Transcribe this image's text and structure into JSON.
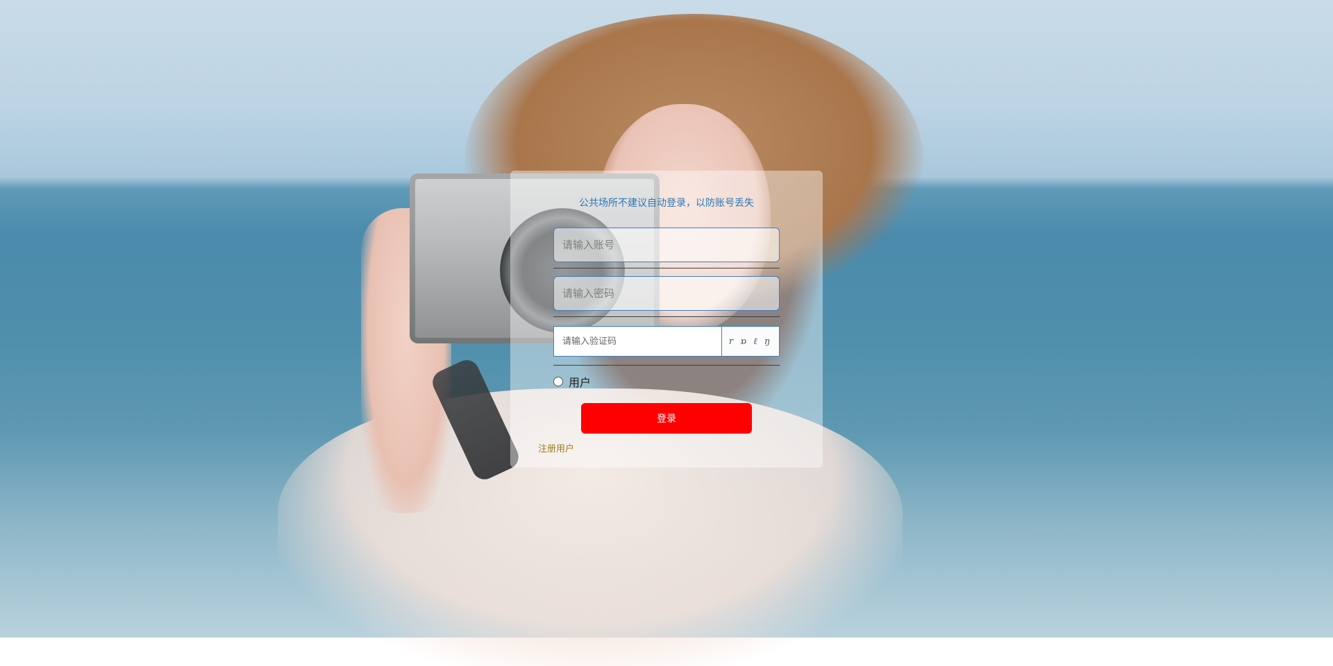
{
  "login": {
    "notice": "公共场所不建议自动登录，以防账号丢失",
    "account_placeholder": "请输入账号",
    "password_placeholder": "请输入密码",
    "captcha_placeholder": "请输入验证码",
    "captcha_text": "r ɒ ℓ ŋ",
    "role_label": "用户",
    "login_label": "登录",
    "register_link": "注册用户"
  },
  "colors": {
    "accent": "#3d7fc0",
    "login_button": "#ff0000",
    "notice_text": "#2b78b4",
    "register_link": "#9b7d1e"
  }
}
